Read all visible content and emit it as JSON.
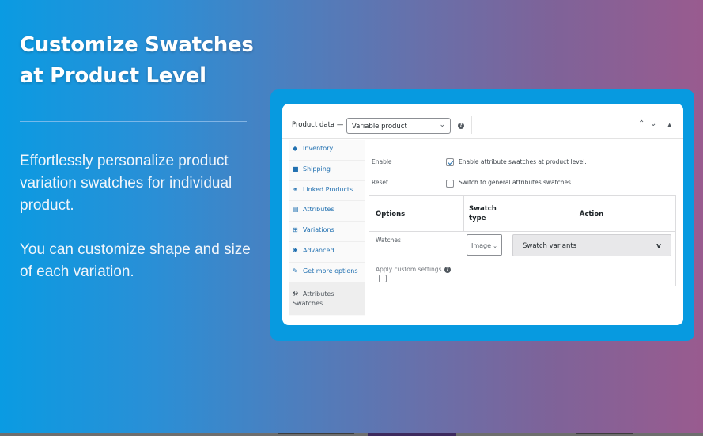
{
  "hero": {
    "title_line1": "Customize Swatches",
    "title_line2": "at Product Level",
    "paragraph1": "Effortlessly personalize product variation swatches for individual product.",
    "paragraph2": "You can customize shape and size of each variation."
  },
  "colors": {
    "gradient_start": "#0a9be2",
    "gradient_end": "#995b8f",
    "frame_blue": "#079ae0",
    "link_blue": "#2271b1"
  },
  "product_data": {
    "label": "Product data —",
    "type_select": {
      "value": "Variable product",
      "chevron": "⌄"
    },
    "help_icon": "?",
    "controls": {
      "move_up": "⌃",
      "move_down": "⌄",
      "toggle": "▲"
    }
  },
  "tabs": [
    {
      "label": "Inventory",
      "icon": "◆",
      "icon_name": "inventory-icon"
    },
    {
      "label": "Shipping",
      "icon": "■",
      "icon_name": "truck-icon"
    },
    {
      "label": "Linked Products",
      "icon": "⚭",
      "icon_name": "link-icon"
    },
    {
      "label": "Attributes",
      "icon": "▤",
      "icon_name": "attributes-icon"
    },
    {
      "label": "Variations",
      "icon": "⊞",
      "icon_name": "grid-icon"
    },
    {
      "label": "Advanced",
      "icon": "✱",
      "icon_name": "gear-icon"
    },
    {
      "label": "Get more options",
      "icon": "✎",
      "icon_name": "plugin-icon"
    },
    {
      "label": "Attributes Swatches",
      "icon": "🔧",
      "icon_name": "wrench-icon",
      "active": true
    }
  ],
  "settings": {
    "enable": {
      "label": "Enable",
      "checked": true,
      "text": "Enable attribute swatches at product level."
    },
    "reset": {
      "label": "Reset",
      "checked": false,
      "text": "Switch to general attributes swatches."
    }
  },
  "swatch_table": {
    "headers": {
      "options": "Options",
      "swatch_type": "Swatch type",
      "action": "Action"
    },
    "rows": [
      {
        "name": "Watches",
        "swatch_type": "Image",
        "action": "Swatch variants",
        "apply_custom_label": "Apply custom settings.",
        "apply_custom_checked": false
      }
    ]
  }
}
